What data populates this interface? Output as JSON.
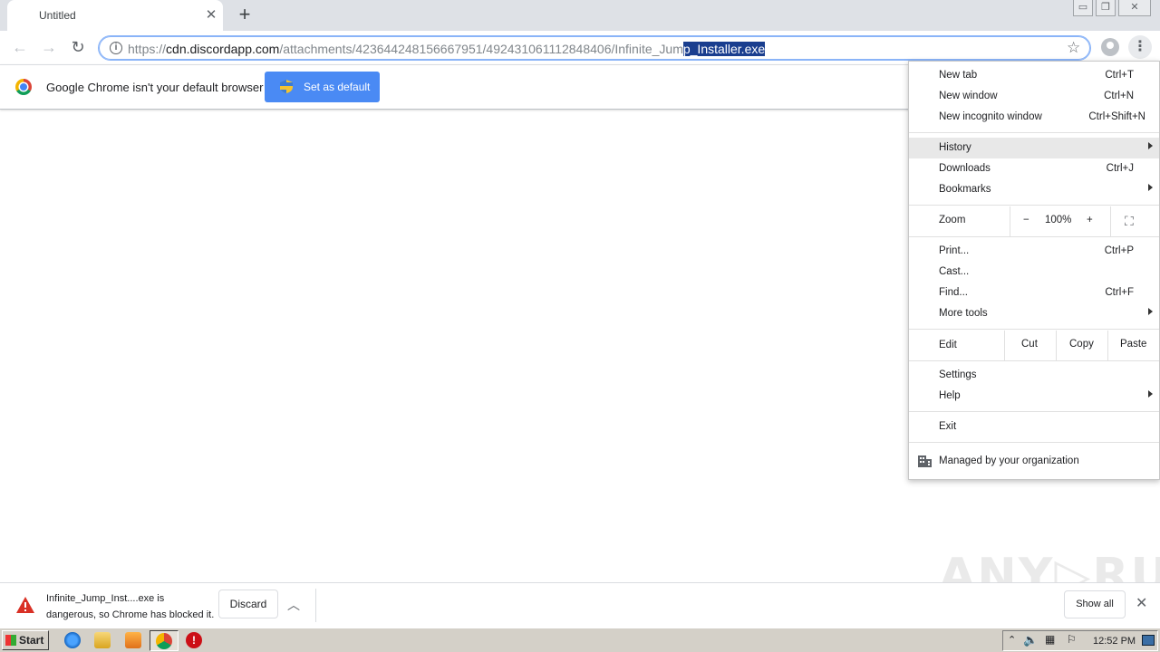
{
  "window": {
    "tab_title": "Untitled",
    "tab_close": "✕",
    "new_tab": "+",
    "controls": [
      "minimize-icon",
      "restore-icon",
      "close-icon"
    ]
  },
  "toolbar": {
    "url_scheme": "https://",
    "url_host": "cdn.discordapp.com",
    "url_path_plain": "/attachments/423644248156667951/492431061112848406/Infinite_Jum",
    "url_path_selected": "p_Installer.exe",
    "icons": [
      "back-icon",
      "forward-icon",
      "reload-icon",
      "info-icon",
      "star-icon",
      "account-icon",
      "menu-icon"
    ]
  },
  "infobar": {
    "message": "Google Chrome isn't your default browser",
    "button": "Set as default"
  },
  "menu": {
    "items_group1": [
      {
        "label": "New tab",
        "shortcut": "Ctrl+T"
      },
      {
        "label": "New window",
        "shortcut": "Ctrl+N"
      },
      {
        "label": "New incognito window",
        "shortcut": "Ctrl+Shift+N"
      }
    ],
    "items_group2": [
      {
        "label": "History",
        "shortcut": "",
        "submenu": true
      },
      {
        "label": "Downloads",
        "shortcut": "Ctrl+J"
      },
      {
        "label": "Bookmarks",
        "shortcut": "",
        "submenu": true
      }
    ],
    "zoom": {
      "label": "Zoom",
      "minus": "−",
      "value": "100%",
      "plus": "+"
    },
    "items_group3": [
      {
        "label": "Print...",
        "shortcut": "Ctrl+P"
      },
      {
        "label": "Cast...",
        "shortcut": ""
      },
      {
        "label": "Find...",
        "shortcut": "Ctrl+F"
      },
      {
        "label": "More tools",
        "shortcut": "",
        "submenu": true
      }
    ],
    "edit": {
      "label": "Edit",
      "cut": "Cut",
      "copy": "Copy",
      "paste": "Paste"
    },
    "items_group4": [
      {
        "label": "Settings",
        "shortcut": ""
      },
      {
        "label": "Help",
        "shortcut": "",
        "submenu": true
      }
    ],
    "exit": "Exit",
    "managed": "Managed by your organization"
  },
  "download": {
    "line1": "Infinite_Jump_Inst....exe is",
    "line2": "dangerous, so Chrome has blocked it.",
    "discard": "Discard",
    "show_all": "Show all"
  },
  "watermark": "ANY▷RUN",
  "taskbar": {
    "start": "Start",
    "clock": "12:52 PM",
    "apps": [
      "ie-icon",
      "explorer-icon",
      "media-player-icon",
      "chrome-icon",
      "opera-icon"
    ]
  },
  "colors": {
    "accent": "#4a8af4",
    "selection": "#1a3e8f",
    "tabstrip": "#dee1e6",
    "taskbar": "#d4d0c8"
  }
}
